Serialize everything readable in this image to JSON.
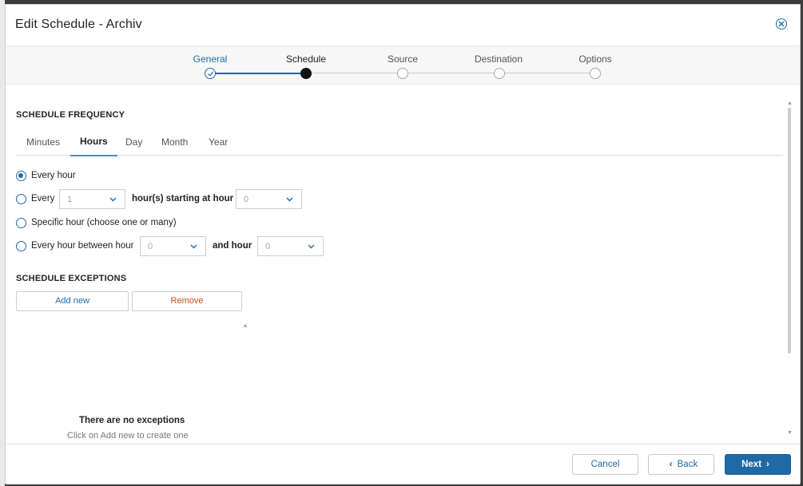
{
  "dialog": {
    "title": "Edit Schedule - Archiv",
    "close_icon": "close-circle-icon"
  },
  "wizard": {
    "steps": [
      {
        "label": "General",
        "state": "done"
      },
      {
        "label": "Schedule",
        "state": "current"
      },
      {
        "label": "Source",
        "state": "pending"
      },
      {
        "label": "Destination",
        "state": "pending"
      },
      {
        "label": "Options",
        "state": "pending"
      }
    ]
  },
  "frequency": {
    "section_title": "SCHEDULE FREQUENCY",
    "tabs": [
      "Minutes",
      "Hours",
      "Day",
      "Month",
      "Year"
    ],
    "active_tab": "Hours",
    "options": {
      "every_hour": {
        "label": "Every hour",
        "checked": true
      },
      "every_n": {
        "label": "Every",
        "value": "1",
        "middle_label": "hour(s) starting at hour",
        "start_value": "0"
      },
      "specific": {
        "label": "Specific hour (choose one or many)"
      },
      "between": {
        "label": "Every hour between hour",
        "from_value": "0",
        "middle_label": "and hour",
        "to_value": "0"
      }
    }
  },
  "exceptions": {
    "section_title": "SCHEDULE EXCEPTIONS",
    "add_label": "Add new",
    "remove_label": "Remove",
    "empty_title": "There are no exceptions",
    "empty_subtitle": "Click on Add new to create one"
  },
  "footer": {
    "cancel_label": "Cancel",
    "back_label": "Back",
    "next_label": "Next"
  },
  "colors": {
    "accent": "#1f6aa5",
    "tab_underline": "#26a0b8",
    "danger": "#d04a20"
  }
}
